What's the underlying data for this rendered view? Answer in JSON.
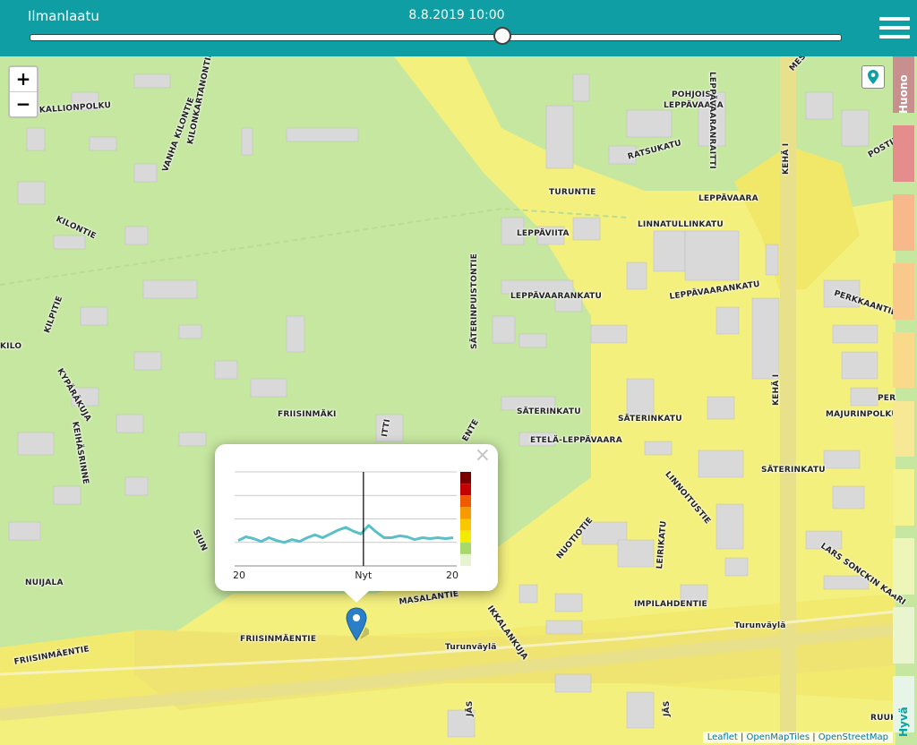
{
  "header": {
    "title": "Ilmanlaatu",
    "datetime": "8.8.2019 10:00",
    "slider_position": 0.583
  },
  "zoom": {
    "in_label": "+",
    "out_label": "−"
  },
  "legend": {
    "top_label": "Huono",
    "bottom_label": "Hyvä",
    "colors": [
      "#c98e8e",
      "#e58d8d",
      "#f7b98c",
      "#f8c98a",
      "#f9d98a",
      "#f7e896",
      "#f4f38e",
      "#edf6b8",
      "#e8f5cf",
      "#e6f5e8"
    ]
  },
  "streets": [
    {
      "text": "ILMANKALLIONPOLKU"
    },
    {
      "text": "VANHA KILONTIE"
    },
    {
      "text": "KILONKARTANONTIE"
    },
    {
      "text": "KILONTIE"
    },
    {
      "text": "POHJOIS-"
    },
    {
      "text": "LEPPÄVAARA"
    },
    {
      "text": "LEPPÄVAARANRAITTI"
    },
    {
      "text": "MESTARINKUJA"
    },
    {
      "text": "POSTIPUU"
    },
    {
      "text": "RATSUKATU"
    },
    {
      "text": "TURUNTIE"
    },
    {
      "text": "LEPPÄVAARA"
    },
    {
      "text": "KEHÄ I"
    },
    {
      "text": "LINNATULLINKATU"
    },
    {
      "text": "LEPPÄVIITA"
    },
    {
      "text": "LEPPÄVAARANKATU"
    },
    {
      "text": "LEPPÄVAARANKATU"
    },
    {
      "text": "PERKKAANTIE"
    },
    {
      "text": "KILPITIE"
    },
    {
      "text": "KILO"
    },
    {
      "text": "KYPÄRÄKUJA"
    },
    {
      "text": "KEIHÄSRINNE"
    },
    {
      "text": "SÄTERINPUISTONTIE"
    },
    {
      "text": "SÄTERINKATU"
    },
    {
      "text": "SÄTERINKATU"
    },
    {
      "text": "SÄTERINKATU"
    },
    {
      "text": "ETELÄ-LEPPÄVAARA"
    },
    {
      "text": "LINNOITUSTIE"
    },
    {
      "text": "KEHÄ I"
    },
    {
      "text": "MAJURINPOLKU"
    },
    {
      "text": "PER"
    },
    {
      "text": "FRIISINMÄKI"
    },
    {
      "text": "LARS SONCKIN KAARI"
    },
    {
      "text": "NUOTIOTIE"
    },
    {
      "text": "LEIRIKATU"
    },
    {
      "text": "IMPILAHDENTIE"
    },
    {
      "text": "NUIJALA"
    },
    {
      "text": "MASALANTIE"
    },
    {
      "text": "IKKALANKUJA"
    },
    {
      "text": "FRIISINMÄENTIE"
    },
    {
      "text": "FRIISINMÄENTIE"
    },
    {
      "text": "Turunväylä"
    },
    {
      "text": "Turunväylä"
    },
    {
      "text": "SIUN"
    },
    {
      "text": "ENTE"
    },
    {
      "text": "ITTI"
    },
    {
      "text": "RUUK"
    },
    {
      "text": "JÄS"
    },
    {
      "text": "JÄS"
    }
  ],
  "popup": {
    "close_label": "×",
    "chart_data": {
      "type": "line",
      "categories": [
        "20",
        "Nyt",
        "20"
      ],
      "now_x": 0.58,
      "values": [
        0.27,
        0.31,
        0.29,
        0.26,
        0.3,
        0.27,
        0.25,
        0.28,
        0.26,
        0.3,
        0.33,
        0.3,
        0.34,
        0.38,
        0.41,
        0.37,
        0.34,
        0.43,
        0.36,
        0.3,
        0.3,
        0.32,
        0.31,
        0.28,
        0.3,
        0.29,
        0.3,
        0.29,
        0.3
      ],
      "ylim": [
        0,
        1
      ],
      "grid": true,
      "line_color": "#5bbfc8",
      "scale_colors": [
        "#7a0000",
        "#c40000",
        "#f05a00",
        "#f79a00",
        "#f9c800",
        "#f4ec00",
        "#a6d96a",
        "#e6f5d0"
      ]
    }
  },
  "attribution": {
    "leaflet": "Leaflet",
    "sep1": " | ",
    "omt": "OpenMapTiles",
    "sep2": " | ",
    "osm": "OpenStreetMap"
  }
}
